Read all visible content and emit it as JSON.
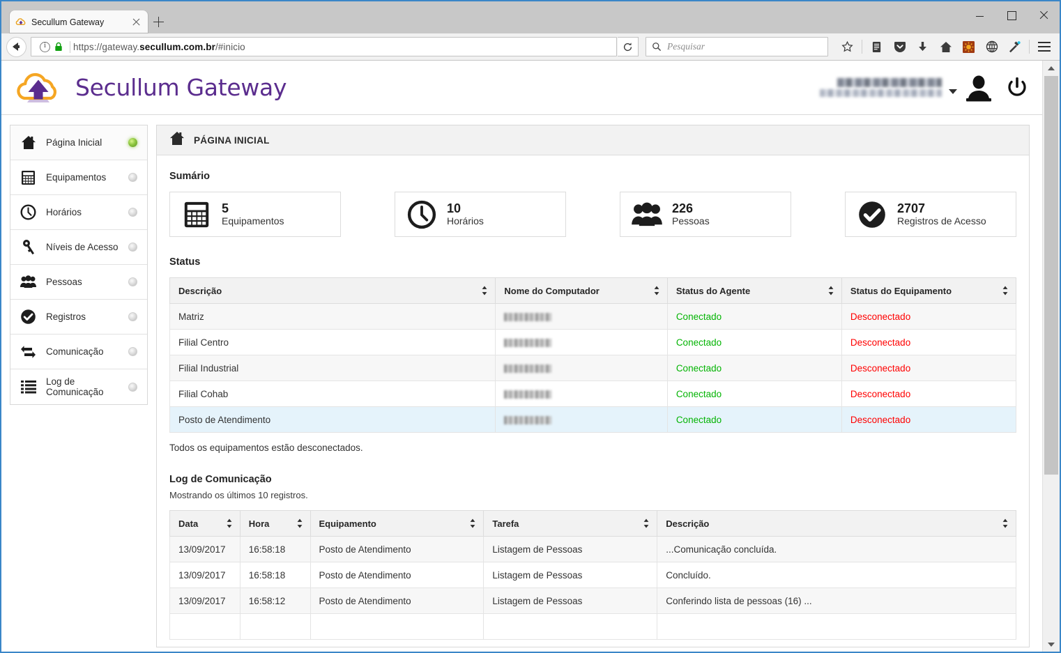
{
  "browser": {
    "tab": {
      "title": "Secullum Gateway",
      "favicon": "cloud-favicon"
    },
    "new_tab_label": "+",
    "url_prefix": "https://gateway.",
    "url_bold": "secullum.com.br",
    "url_suffix": "/#inicio",
    "search_placeholder": "Pesquisar",
    "toolbar_icons": [
      "star-icon",
      "reader-icon",
      "pocket-icon",
      "download-icon",
      "home-icon",
      "extension-icon",
      "globe-icon",
      "devtools-icon",
      "menu-icon"
    ],
    "window_controls": [
      "minimize",
      "maximize",
      "close"
    ]
  },
  "app": {
    "brand": "Secullum Gateway",
    "page_header": "PÁGINA INICIAL"
  },
  "sidebar": {
    "items": [
      {
        "label": "Página Inicial",
        "icon": "home-icon",
        "status": "on"
      },
      {
        "label": "Equipamentos",
        "icon": "calculator-icon",
        "status": "off"
      },
      {
        "label": "Horários",
        "icon": "clock-icon",
        "status": "off"
      },
      {
        "label": "Níveis de Acesso",
        "icon": "key-icon",
        "status": "off"
      },
      {
        "label": "Pessoas",
        "icon": "people-icon",
        "status": "off"
      },
      {
        "label": "Registros",
        "icon": "check-icon",
        "status": "off"
      },
      {
        "label": "Comunicação",
        "icon": "sync-icon",
        "status": "off"
      },
      {
        "label": "Log de Comunicação",
        "icon": "list-icon",
        "status": "off"
      }
    ]
  },
  "summary": {
    "title": "Sumário",
    "cards": [
      {
        "value": "5",
        "label": "Equipamentos",
        "icon": "calculator-icon"
      },
      {
        "value": "10",
        "label": "Horários",
        "icon": "clock-icon"
      },
      {
        "value": "226",
        "label": "Pessoas",
        "icon": "people-icon"
      },
      {
        "value": "2707",
        "label": "Registros de Acesso",
        "icon": "check-circle-icon"
      }
    ]
  },
  "status_section": {
    "title": "Status",
    "columns": [
      "Descrição",
      "Nome do Computador",
      "Status do Agente",
      "Status do Equipamento"
    ],
    "rows": [
      {
        "descricao": "Matriz",
        "computador": "",
        "agente": "Conectado",
        "equipamento": "Desconectado"
      },
      {
        "descricao": "Filial Centro",
        "computador": "",
        "agente": "Conectado",
        "equipamento": "Desconectado"
      },
      {
        "descricao": "Filial Industrial",
        "computador": "",
        "agente": "Conectado",
        "equipamento": "Desconectado"
      },
      {
        "descricao": "Filial Cohab",
        "computador": "",
        "agente": "Conectado",
        "equipamento": "Desconectado"
      },
      {
        "descricao": "Posto de Atendimento",
        "computador": "",
        "agente": "Conectado",
        "equipamento": "Desconectado"
      }
    ],
    "note": "Todos os equipamentos estão desconectados."
  },
  "log_section": {
    "title": "Log de Comunicação",
    "note": "Mostrando os últimos 10 registros.",
    "columns": [
      "Data",
      "Hora",
      "Equipamento",
      "Tarefa",
      "Descrição"
    ],
    "rows": [
      {
        "data": "13/09/2017",
        "hora": "16:58:18",
        "equipamento": "Posto de Atendimento",
        "tarefa": "Listagem de Pessoas",
        "descricao": "...Comunicação concluída."
      },
      {
        "data": "13/09/2017",
        "hora": "16:58:18",
        "equipamento": "Posto de Atendimento",
        "tarefa": "Listagem de Pessoas",
        "descricao": "Concluído."
      },
      {
        "data": "13/09/2017",
        "hora": "16:58:12",
        "equipamento": "Posto de Atendimento",
        "tarefa": "Listagem de Pessoas",
        "descricao": "Conferindo lista de pessoas (16) ..."
      }
    ]
  },
  "colors": {
    "brand_purple": "#5b2d8e",
    "logo_orange": "#f5a623",
    "connected_green": "#04b404",
    "disconnected_red": "#ff0000",
    "row_highlight": "#e5f3fb"
  }
}
